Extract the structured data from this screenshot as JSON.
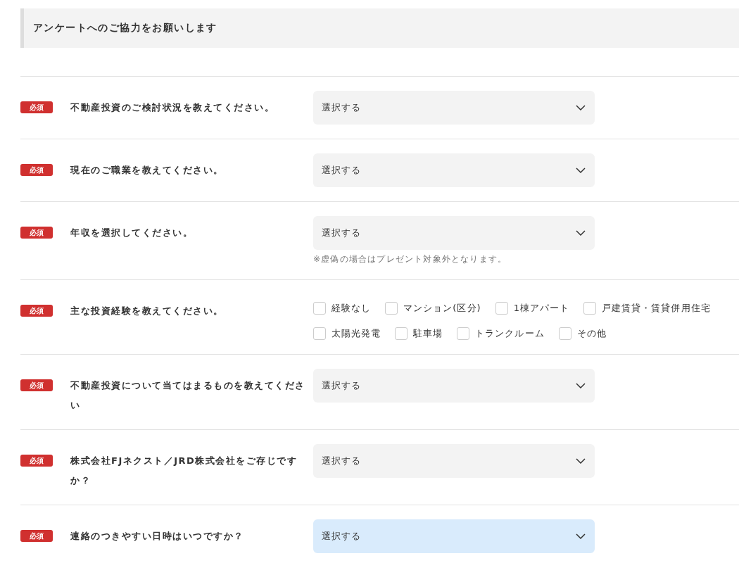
{
  "heading": "アンケートへのご協力をお願いします",
  "questions": [
    {
      "badge": "必須",
      "label": "不動産投資のご検討状況を教えてください。",
      "kind": "select",
      "value": "選択する",
      "focused": false
    },
    {
      "badge": "必須",
      "label": "現在のご職業を教えてください。",
      "kind": "select",
      "value": "選択する",
      "focused": false
    },
    {
      "badge": "必須",
      "label": "年収を選択してください。",
      "kind": "select",
      "value": "選択する",
      "focused": false,
      "note": "※虚偽の場合はプレゼント対象外となります。"
    },
    {
      "badge": "必須",
      "label": "主な投資経験を教えてください。",
      "kind": "checkboxes",
      "options": [
        {
          "label": "経験なし",
          "checked": false
        },
        {
          "label": "マンション(区分)",
          "checked": false
        },
        {
          "label": "1棟アパート",
          "checked": false
        },
        {
          "label": "戸建賃貸・賃貸併用住宅",
          "checked": false
        },
        {
          "label": "太陽光発電",
          "checked": false
        },
        {
          "label": "駐車場",
          "checked": false
        },
        {
          "label": "トランクルーム",
          "checked": false
        },
        {
          "label": "その他",
          "checked": false
        }
      ]
    },
    {
      "badge": "必須",
      "label": "不動産投資について当てはまるものを教えてください",
      "kind": "select",
      "value": "選択する",
      "focused": false
    },
    {
      "badge": "必須",
      "label": "株式会社FJネクスト／JRD株式会社をご存じですか？",
      "kind": "select",
      "value": "選択する",
      "focused": false
    },
    {
      "badge": "必須",
      "label": "連絡のつきやすい日時はいつですか？",
      "kind": "select",
      "value": "選択する",
      "focused": true
    }
  ]
}
